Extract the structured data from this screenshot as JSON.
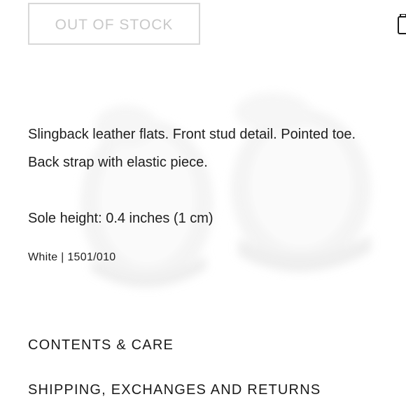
{
  "product": {
    "stock_button_label": "OUT OF STOCK",
    "description_lines": [
      "Slingback leather flats. Front stud detail. Pointed toe.",
      "Back strap with elastic piece."
    ],
    "sole_height": "Sole height: 0.4 inches (1 cm)",
    "color_reference": "White | 1501/010"
  },
  "accordion": {
    "contents_care": "CONTENTS & CARE",
    "shipping_returns": "SHIPPING, EXCHANGES AND RETURNS"
  },
  "icons": {
    "bag": "shopping-bag-icon"
  },
  "colors": {
    "text": "#1e1e1e",
    "disabled_text": "#c8c8c8",
    "disabled_border": "#d8d8d8",
    "background": "#ffffff"
  }
}
